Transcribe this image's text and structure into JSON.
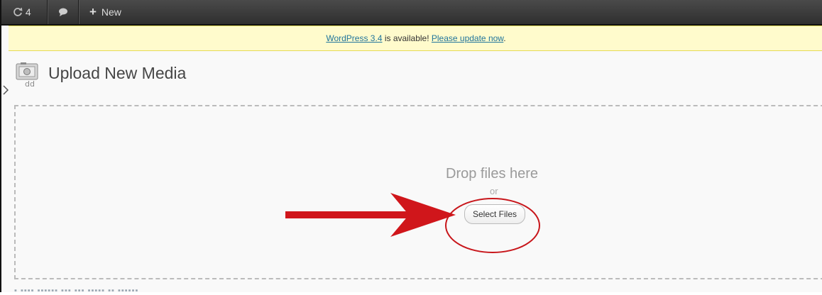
{
  "adminbar": {
    "updates_count": "4",
    "new_label": "New"
  },
  "notice": {
    "version_link": "WordPress 3.4",
    "middle_text": " is available! ",
    "update_link": "Please update now",
    "end_text": "."
  },
  "page": {
    "title": "Upload New Media"
  },
  "uploader": {
    "drop_text": "Drop files here",
    "or_text": "or",
    "select_button": "Select Files"
  },
  "annotation": {
    "arrow_color": "#d0161b",
    "circle_color": "#c8161b"
  },
  "colors": {
    "adminbar_bg": "#3a3a3a",
    "notice_bg": "#fffbcc",
    "link": "#21759b"
  }
}
